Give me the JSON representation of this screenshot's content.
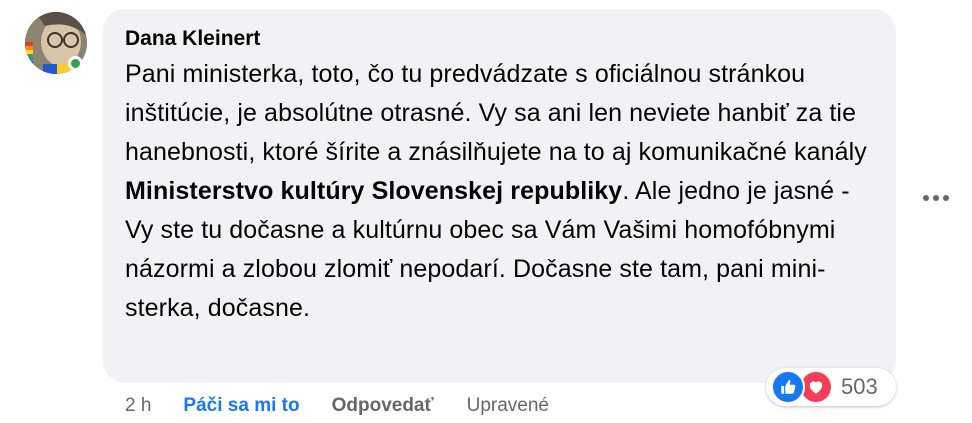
{
  "comment": {
    "author": "Dana Kleinert",
    "text_before_mention": "Pani ministerka, toto, čo tu predvádzate s oficiálnou stránkou inštitúcie, je absolútne otrasné. Vy sa ani len neviete hanbiť za tie hanebnosti, ktoré šírite a znásilňujete na to aj komunikačné kanály ",
    "mention": "Ministerstvo kultúry Slovenskej republiky",
    "text_after_mention": ". Ale jedno je jasné - Vy ste tu dočasne a kultúrnu obec sa Vám Vašimi homofóbnymi názormi a zlobou zlomiť nepodarí. Dočasne ste tam, pani mini-sterka, dočasne.",
    "online": true
  },
  "reactions": {
    "icons": [
      "like-icon",
      "love-icon"
    ],
    "count": "503"
  },
  "actions": {
    "time": "2 h",
    "like_label": "Páči sa mi to",
    "reply_label": "Odpovedať",
    "edited_label": "Upravené"
  },
  "colors": {
    "bubble": "#f0f2f5",
    "link_blue": "#1877f2",
    "secondary": "#65676b",
    "online": "#31a24c",
    "love": "#f33e58"
  }
}
